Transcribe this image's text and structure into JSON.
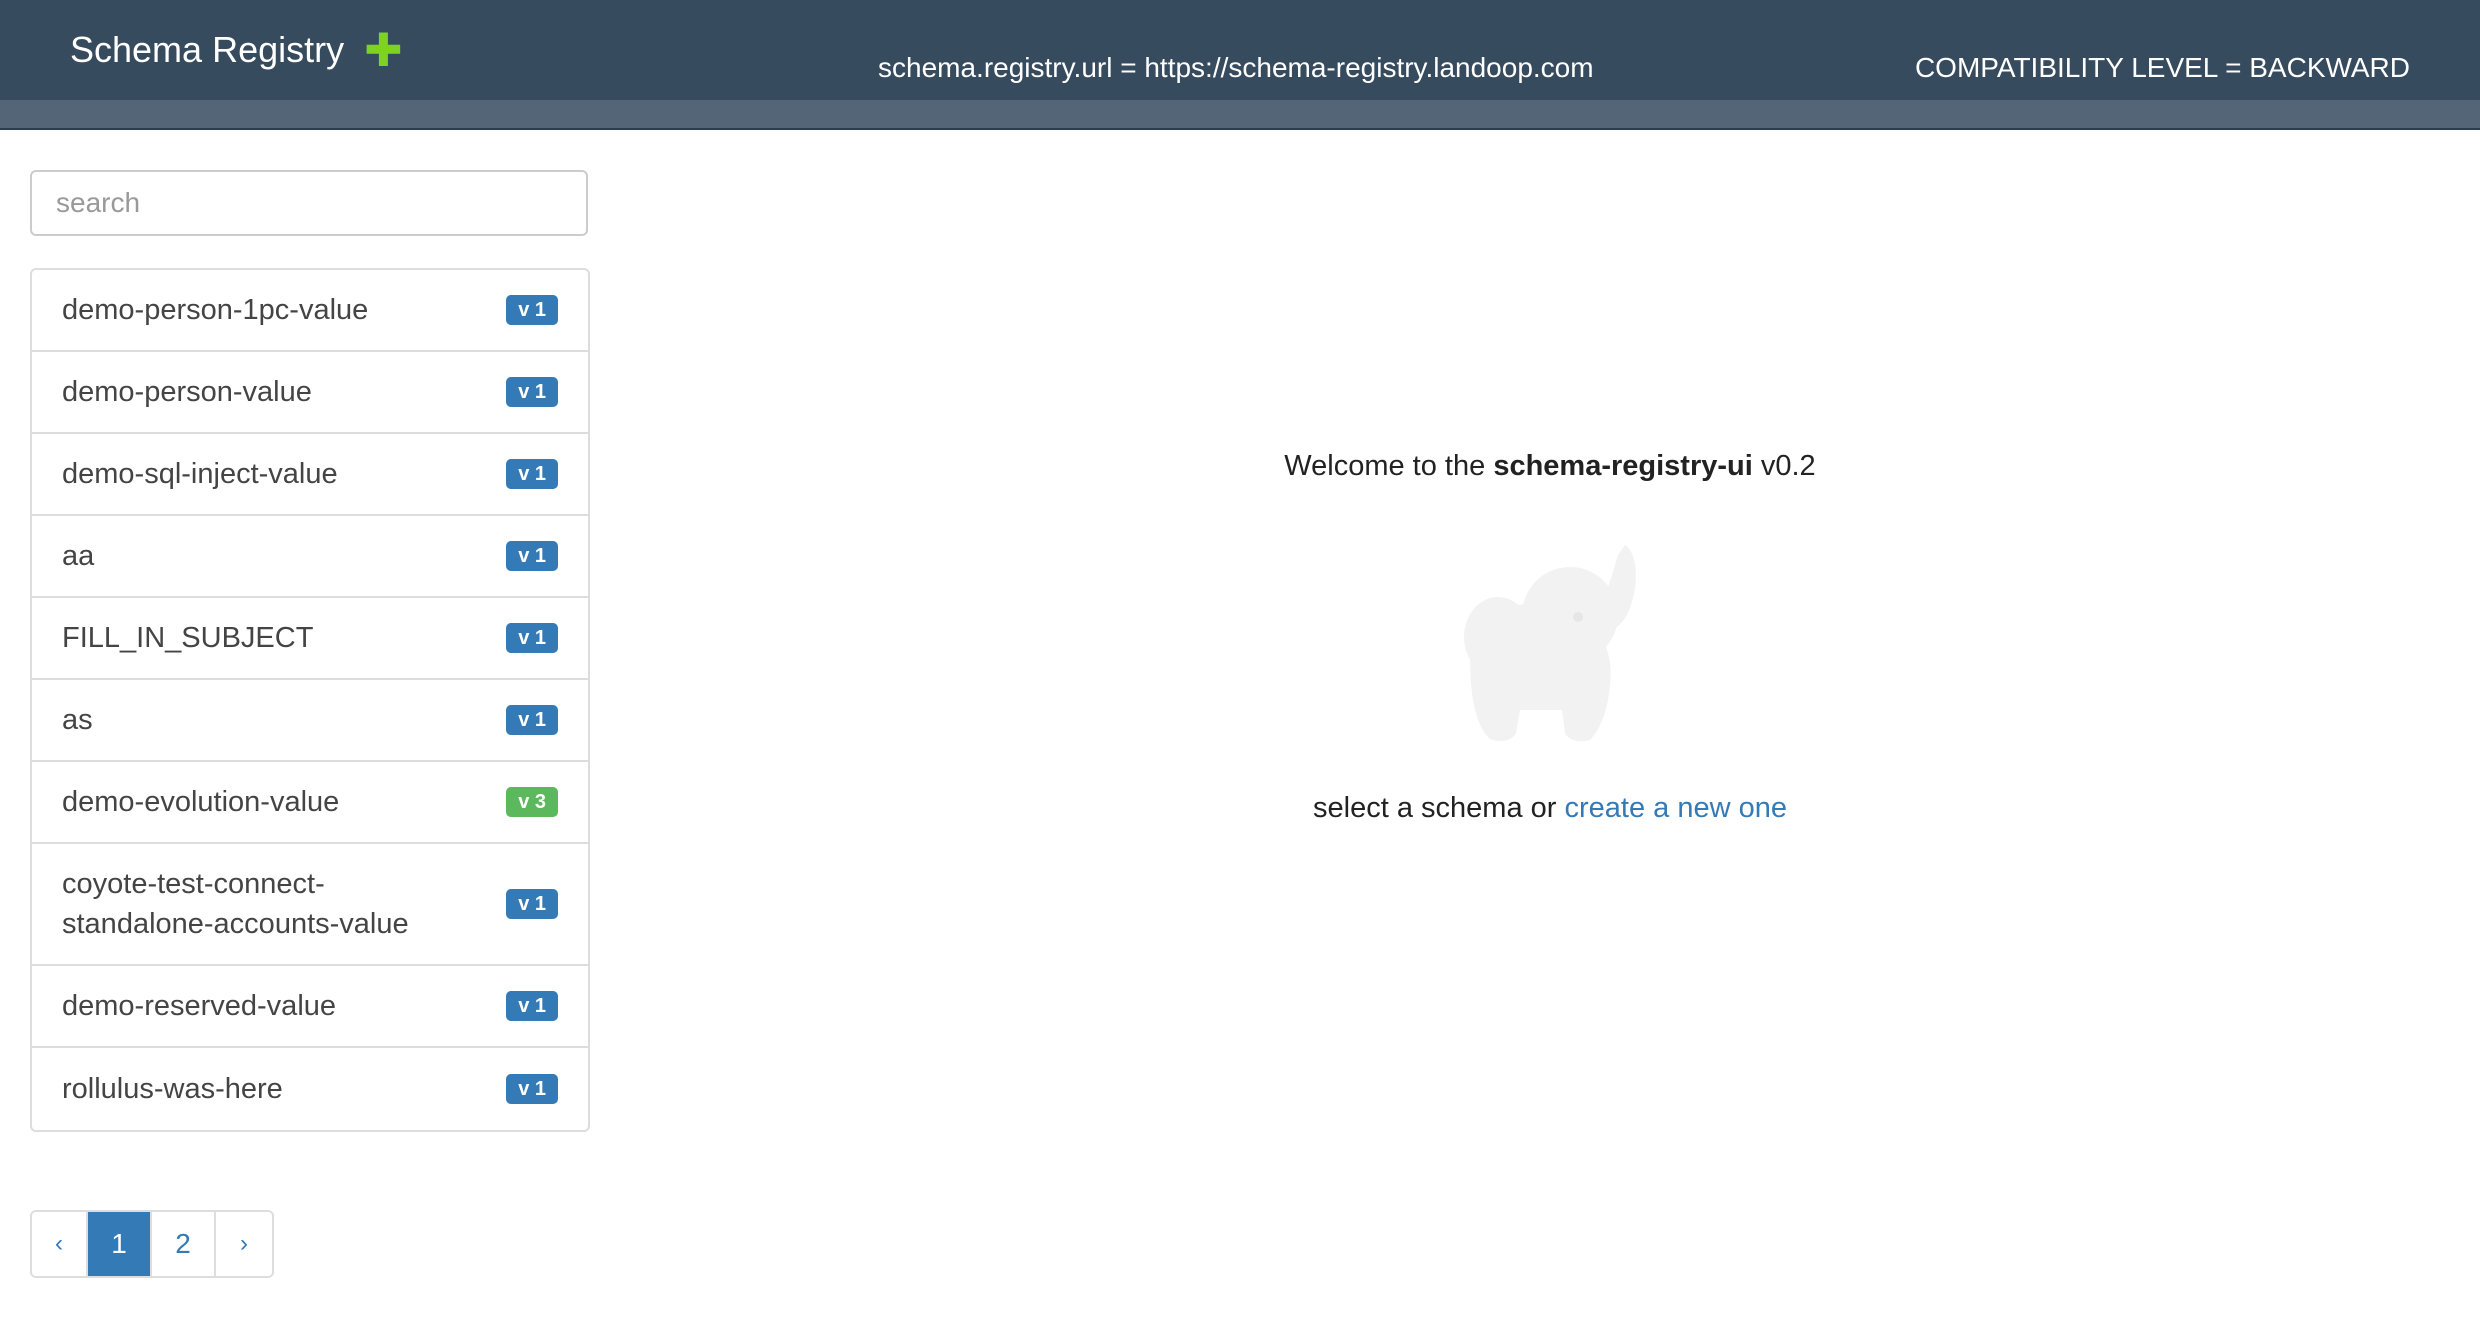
{
  "header": {
    "title": "Schema Registry",
    "add_icon": "plus-icon",
    "registry_url": "schema.registry.url = https://schema-registry.landoop.com",
    "compatibility": "COMPATIBILITY LEVEL = BACKWARD"
  },
  "sidebar": {
    "search_placeholder": "search",
    "search_value": "",
    "items": [
      {
        "label": "demo-person-1pc-value",
        "version": "v 1",
        "badge_color": "#337ab7"
      },
      {
        "label": "demo-person-value",
        "version": "v 1",
        "badge_color": "#337ab7"
      },
      {
        "label": "demo-sql-inject-value",
        "version": "v 1",
        "badge_color": "#337ab7"
      },
      {
        "label": "aa",
        "version": "v 1",
        "badge_color": "#337ab7"
      },
      {
        "label": "FILL_IN_SUBJECT",
        "version": "v 1",
        "badge_color": "#337ab7"
      },
      {
        "label": "as",
        "version": "v 1",
        "badge_color": "#337ab7"
      },
      {
        "label": "demo-evolution-value",
        "version": "v 3",
        "badge_color": "#5cb85c"
      },
      {
        "label": "coyote-test-connect-standalone-accounts-value",
        "version": "v 1",
        "badge_color": "#337ab7"
      },
      {
        "label": "demo-reserved-value",
        "version": "v 1",
        "badge_color": "#337ab7"
      },
      {
        "label": "rollulus-was-here",
        "version": "v 1",
        "badge_color": "#337ab7"
      }
    ]
  },
  "pagination": {
    "prev": "‹",
    "pages": [
      "1",
      "2"
    ],
    "current": "1",
    "next": "›"
  },
  "main": {
    "welcome_prefix": "Welcome to the",
    "welcome_app": "schema-registry-ui",
    "welcome_version": "v0.2",
    "logo_icon": "elephant-icon",
    "select_text": "select a schema or",
    "create_link": "create a new one"
  },
  "colors": {
    "navbar": "#374b5e",
    "navbar_sub": "#536576",
    "accent": "#337ab7",
    "plus": "#7ed321",
    "badge_green": "#5cb85c"
  }
}
